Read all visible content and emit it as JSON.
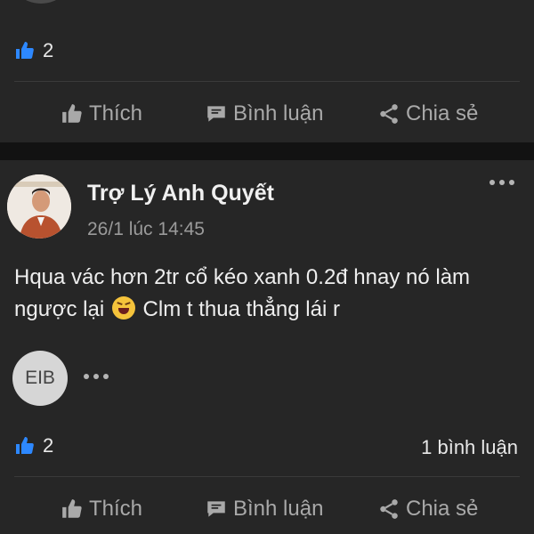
{
  "post_prev": {
    "like_count": "2",
    "actions": {
      "like": "Thích",
      "comment": "Bình luận",
      "share": "Chia sẻ"
    }
  },
  "post": {
    "author": "Trợ Lý Anh Quyết",
    "timestamp": "26/1 lúc 14:45",
    "text_part1": "Hqua vác hơn 2tr cổ kéo xanh 0.2đ hnay nó làm ngược lại",
    "text_part2": "Clm t thua thẳng lái r",
    "page_initials": "EIB",
    "like_count": "2",
    "comment_count": "1 bình luận",
    "actions": {
      "like": "Thích",
      "comment": "Bình luận",
      "share": "Chia sẻ"
    }
  },
  "colors": {
    "background": "#262626",
    "separator": "#121212",
    "like_blue": "#2d88ff",
    "muted": "#a9a9a9"
  },
  "icons": [
    "like-icon",
    "comment-icon",
    "share-icon",
    "more-icon",
    "laughing-emoji-icon"
  ]
}
